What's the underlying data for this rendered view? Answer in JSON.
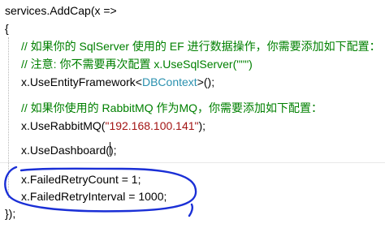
{
  "code": {
    "line1": "services.AddCap(x =>",
    "line2": "{",
    "line3": "// 如果你的 SqlServer 使用的 EF 进行数据操作，你需要添加如下配置：",
    "line4": "// 注意: 你不需要再次配置 x.UseSqlServer(\"\"\")",
    "line5_prefix": "x.UseEntityFramework<",
    "line5_type": "DBContext",
    "line5_suffix": ">();",
    "line7": "// 如果你使用的 RabbitMQ 作为MQ，你需要添加如下配置：",
    "line8_prefix": "x.UseRabbitMQ(",
    "line8_string": "\"192.168.100.141\"",
    "line8_suffix": ");",
    "line10": "x.UseDashboard();",
    "line12": "x.FailedRetryCount = 1;",
    "line13": "x.FailedRetryInterval = 1000;",
    "line14": "});"
  },
  "colors": {
    "comment": "#008000",
    "type": "#2b91af",
    "string": "#a31515",
    "annotation": "#1a2fd6"
  },
  "annotation": {
    "shape": "hand-drawn ellipse",
    "encloses": "failed-retry-settings"
  }
}
